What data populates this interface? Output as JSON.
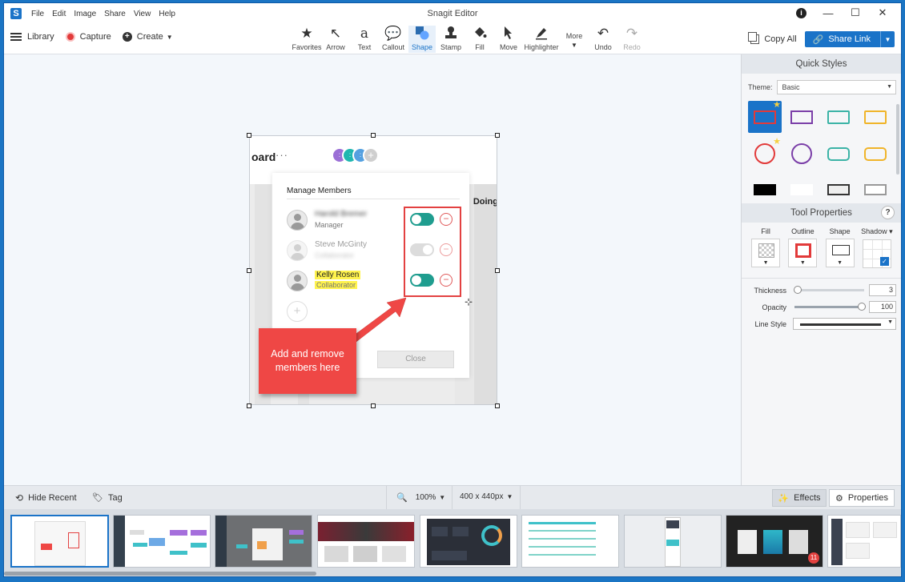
{
  "window": {
    "title": "Snagit Editor",
    "menus": [
      "File",
      "Edit",
      "Image",
      "Share",
      "View",
      "Help"
    ]
  },
  "toolbar": {
    "library": "Library",
    "capture": "Capture",
    "create": "Create",
    "tools": [
      {
        "label": "Favorites",
        "icon": "star-icon"
      },
      {
        "label": "Arrow",
        "icon": "arrow-icon"
      },
      {
        "label": "Text",
        "icon": "text-icon"
      },
      {
        "label": "Callout",
        "icon": "callout-icon"
      },
      {
        "label": "Shape",
        "icon": "shape-icon"
      },
      {
        "label": "Stamp",
        "icon": "stamp-icon"
      },
      {
        "label": "Fill",
        "icon": "fill-bucket-icon"
      },
      {
        "label": "Move",
        "icon": "move-cursor-icon"
      },
      {
        "label": "Highlighter",
        "icon": "highlighter-icon"
      },
      {
        "label": "More",
        "icon": "more-icon"
      },
      {
        "label": "Undo",
        "icon": "undo-icon"
      },
      {
        "label": "Redo",
        "icon": "redo-icon"
      }
    ],
    "copy_all": "Copy All",
    "share_link": "Share Link"
  },
  "canvas": {
    "capture_title": "oard",
    "doing_label": "Doing",
    "panel": {
      "title": "Manage Members",
      "members": [
        {
          "name": "Harold Bremer",
          "role": "Manager"
        },
        {
          "name": "Steve McGinty",
          "role": "Collaborator"
        },
        {
          "name": "Kelly Rosen",
          "role": "Collaborator"
        }
      ],
      "close_label": "Close"
    },
    "callout_text_1": "Add and remove",
    "callout_text_2": "members here"
  },
  "right_panel": {
    "quick_styles_title": "Quick Styles",
    "theme_label": "Theme:",
    "theme_value": "Basic",
    "tool_properties_title": "Tool Properties",
    "help": "?",
    "props": [
      "Fill",
      "Outline",
      "Shape",
      "Shadow"
    ],
    "thickness_label": "Thickness",
    "thickness_value": "3",
    "opacity_label": "Opacity",
    "opacity_value": "100",
    "line_style_label": "Line Style"
  },
  "bottom_bar": {
    "hide_recent": "Hide Recent",
    "tag": "Tag",
    "zoom": "100%",
    "size": "400 x 440px",
    "effects": "Effects",
    "properties": "Properties"
  },
  "tray": {
    "badge": "11"
  },
  "colors": {
    "accent": "#1a73c8",
    "callout": "#ef4745",
    "toggle_on": "#1f9d8f"
  }
}
